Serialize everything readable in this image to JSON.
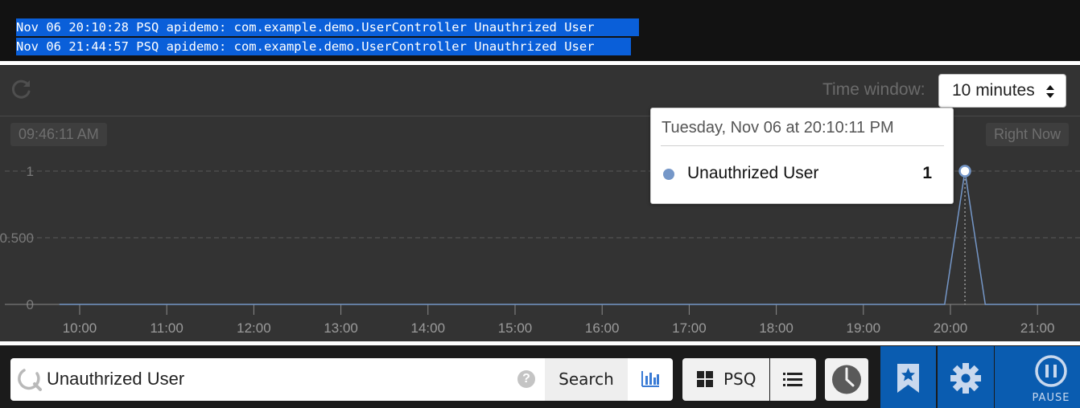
{
  "logs": {
    "lines": [
      "Nov 06 20:10:28 PSQ apidemo: com.example.demo.UserController Unauthrized User",
      "Nov 06 21:44:57 PSQ apidemo: com.example.demo.UserController Unauthrized User"
    ]
  },
  "chart_panel": {
    "time_window_label": "Time window:",
    "time_window_value": "10 minutes",
    "start_time": "09:46:11 AM",
    "end_time": "Right Now",
    "tooltip": {
      "date": "Tuesday, Nov 06 at 20:10:11 PM",
      "series_name": "Unauthrized User",
      "value": "1"
    }
  },
  "chart_data": {
    "type": "line",
    "x_tick_labels": [
      "10:00",
      "11:00",
      "12:00",
      "13:00",
      "14:00",
      "15:00",
      "16:00",
      "17:00",
      "18:00",
      "19:00",
      "20:00",
      "21:00"
    ],
    "y_tick_labels": [
      "1",
      "0.500",
      "0"
    ],
    "ylim": [
      0,
      1
    ],
    "series": [
      {
        "name": "Unauthrized User",
        "color": "#7597c8",
        "points": [
          [
            "09:46",
            0
          ],
          [
            "19:56",
            0
          ],
          [
            "20:10",
            1
          ],
          [
            "20:24",
            0
          ],
          [
            "21:40",
            0
          ]
        ]
      }
    ],
    "highlighted_point": [
      "20:10",
      1
    ],
    "grid": true
  },
  "bottom_bar": {
    "search_value": "Unauthrized User",
    "help_label": "?",
    "search_button": "Search",
    "source_label": "PSQ",
    "pause_label": "PAUSE"
  },
  "colors": {
    "selection_blue": "#0a5fd9",
    "action_blue": "#0a5cb0",
    "series_blue": "#7597c8",
    "panel_bg": "#333333"
  }
}
